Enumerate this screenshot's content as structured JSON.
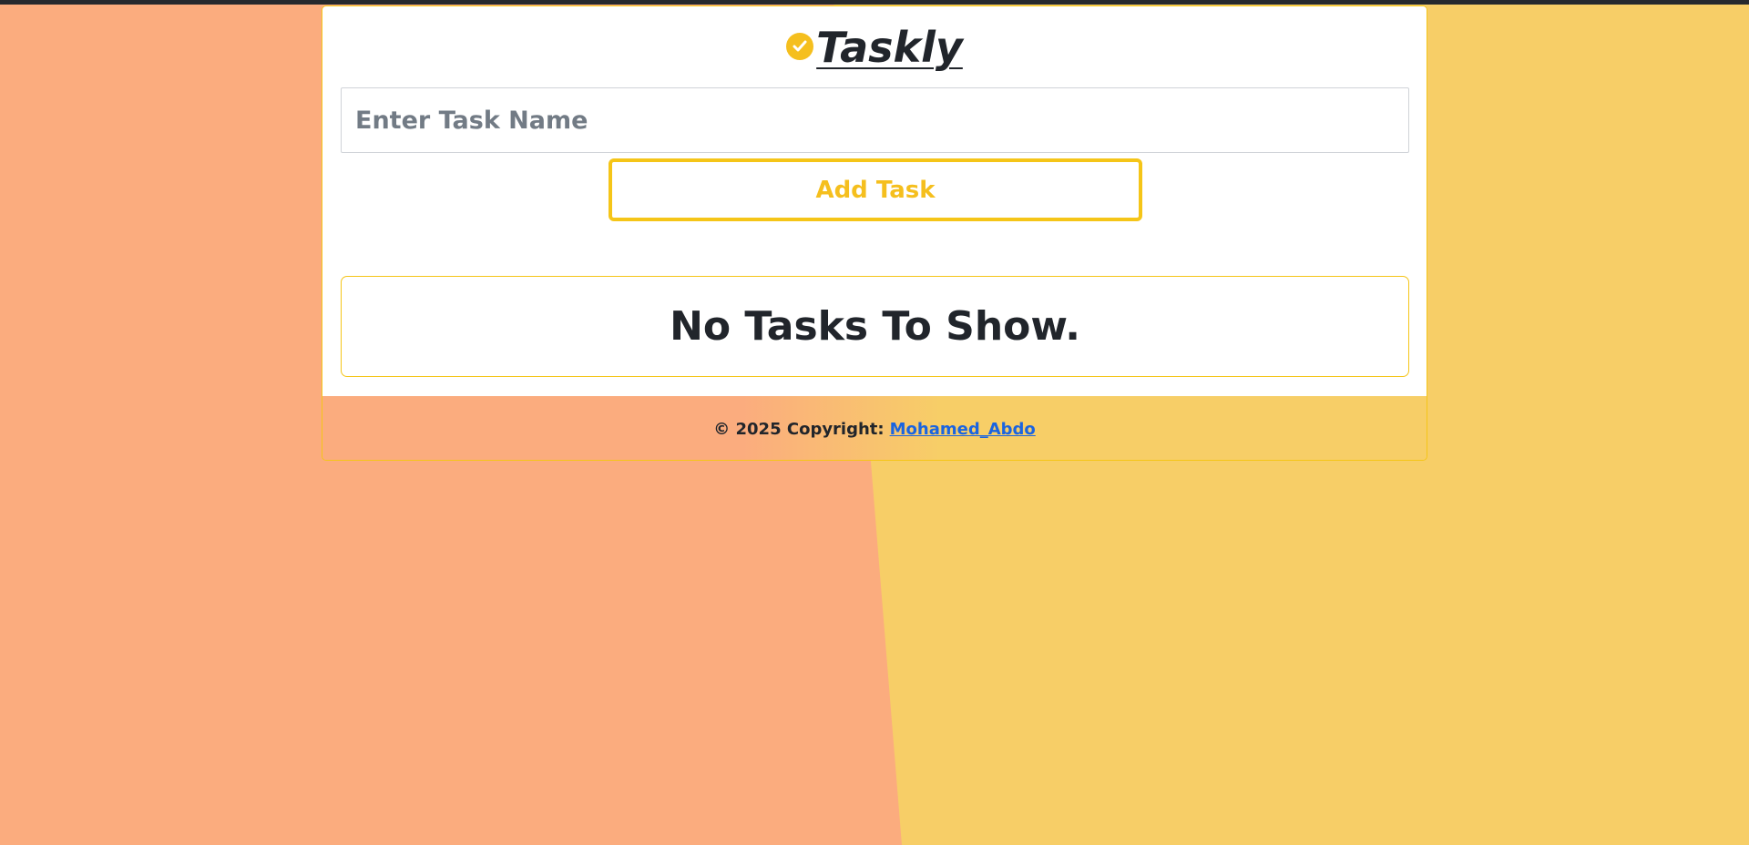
{
  "app": {
    "title": "Taskly",
    "icon": "check-circle-icon"
  },
  "form": {
    "input_placeholder": "Enter Task Name",
    "input_value": "",
    "add_button_label": "Add Task"
  },
  "tasks": {
    "empty_message": "No Tasks To Show.",
    "items": []
  },
  "footer": {
    "copyright_text": "© 2025 Copyright:",
    "author_link": "Mohamed_Abdo"
  },
  "colors": {
    "accent": "#f5c518",
    "background_left": "#fbac7e",
    "background_right": "#f7ce67",
    "link": "#1a64e0"
  }
}
